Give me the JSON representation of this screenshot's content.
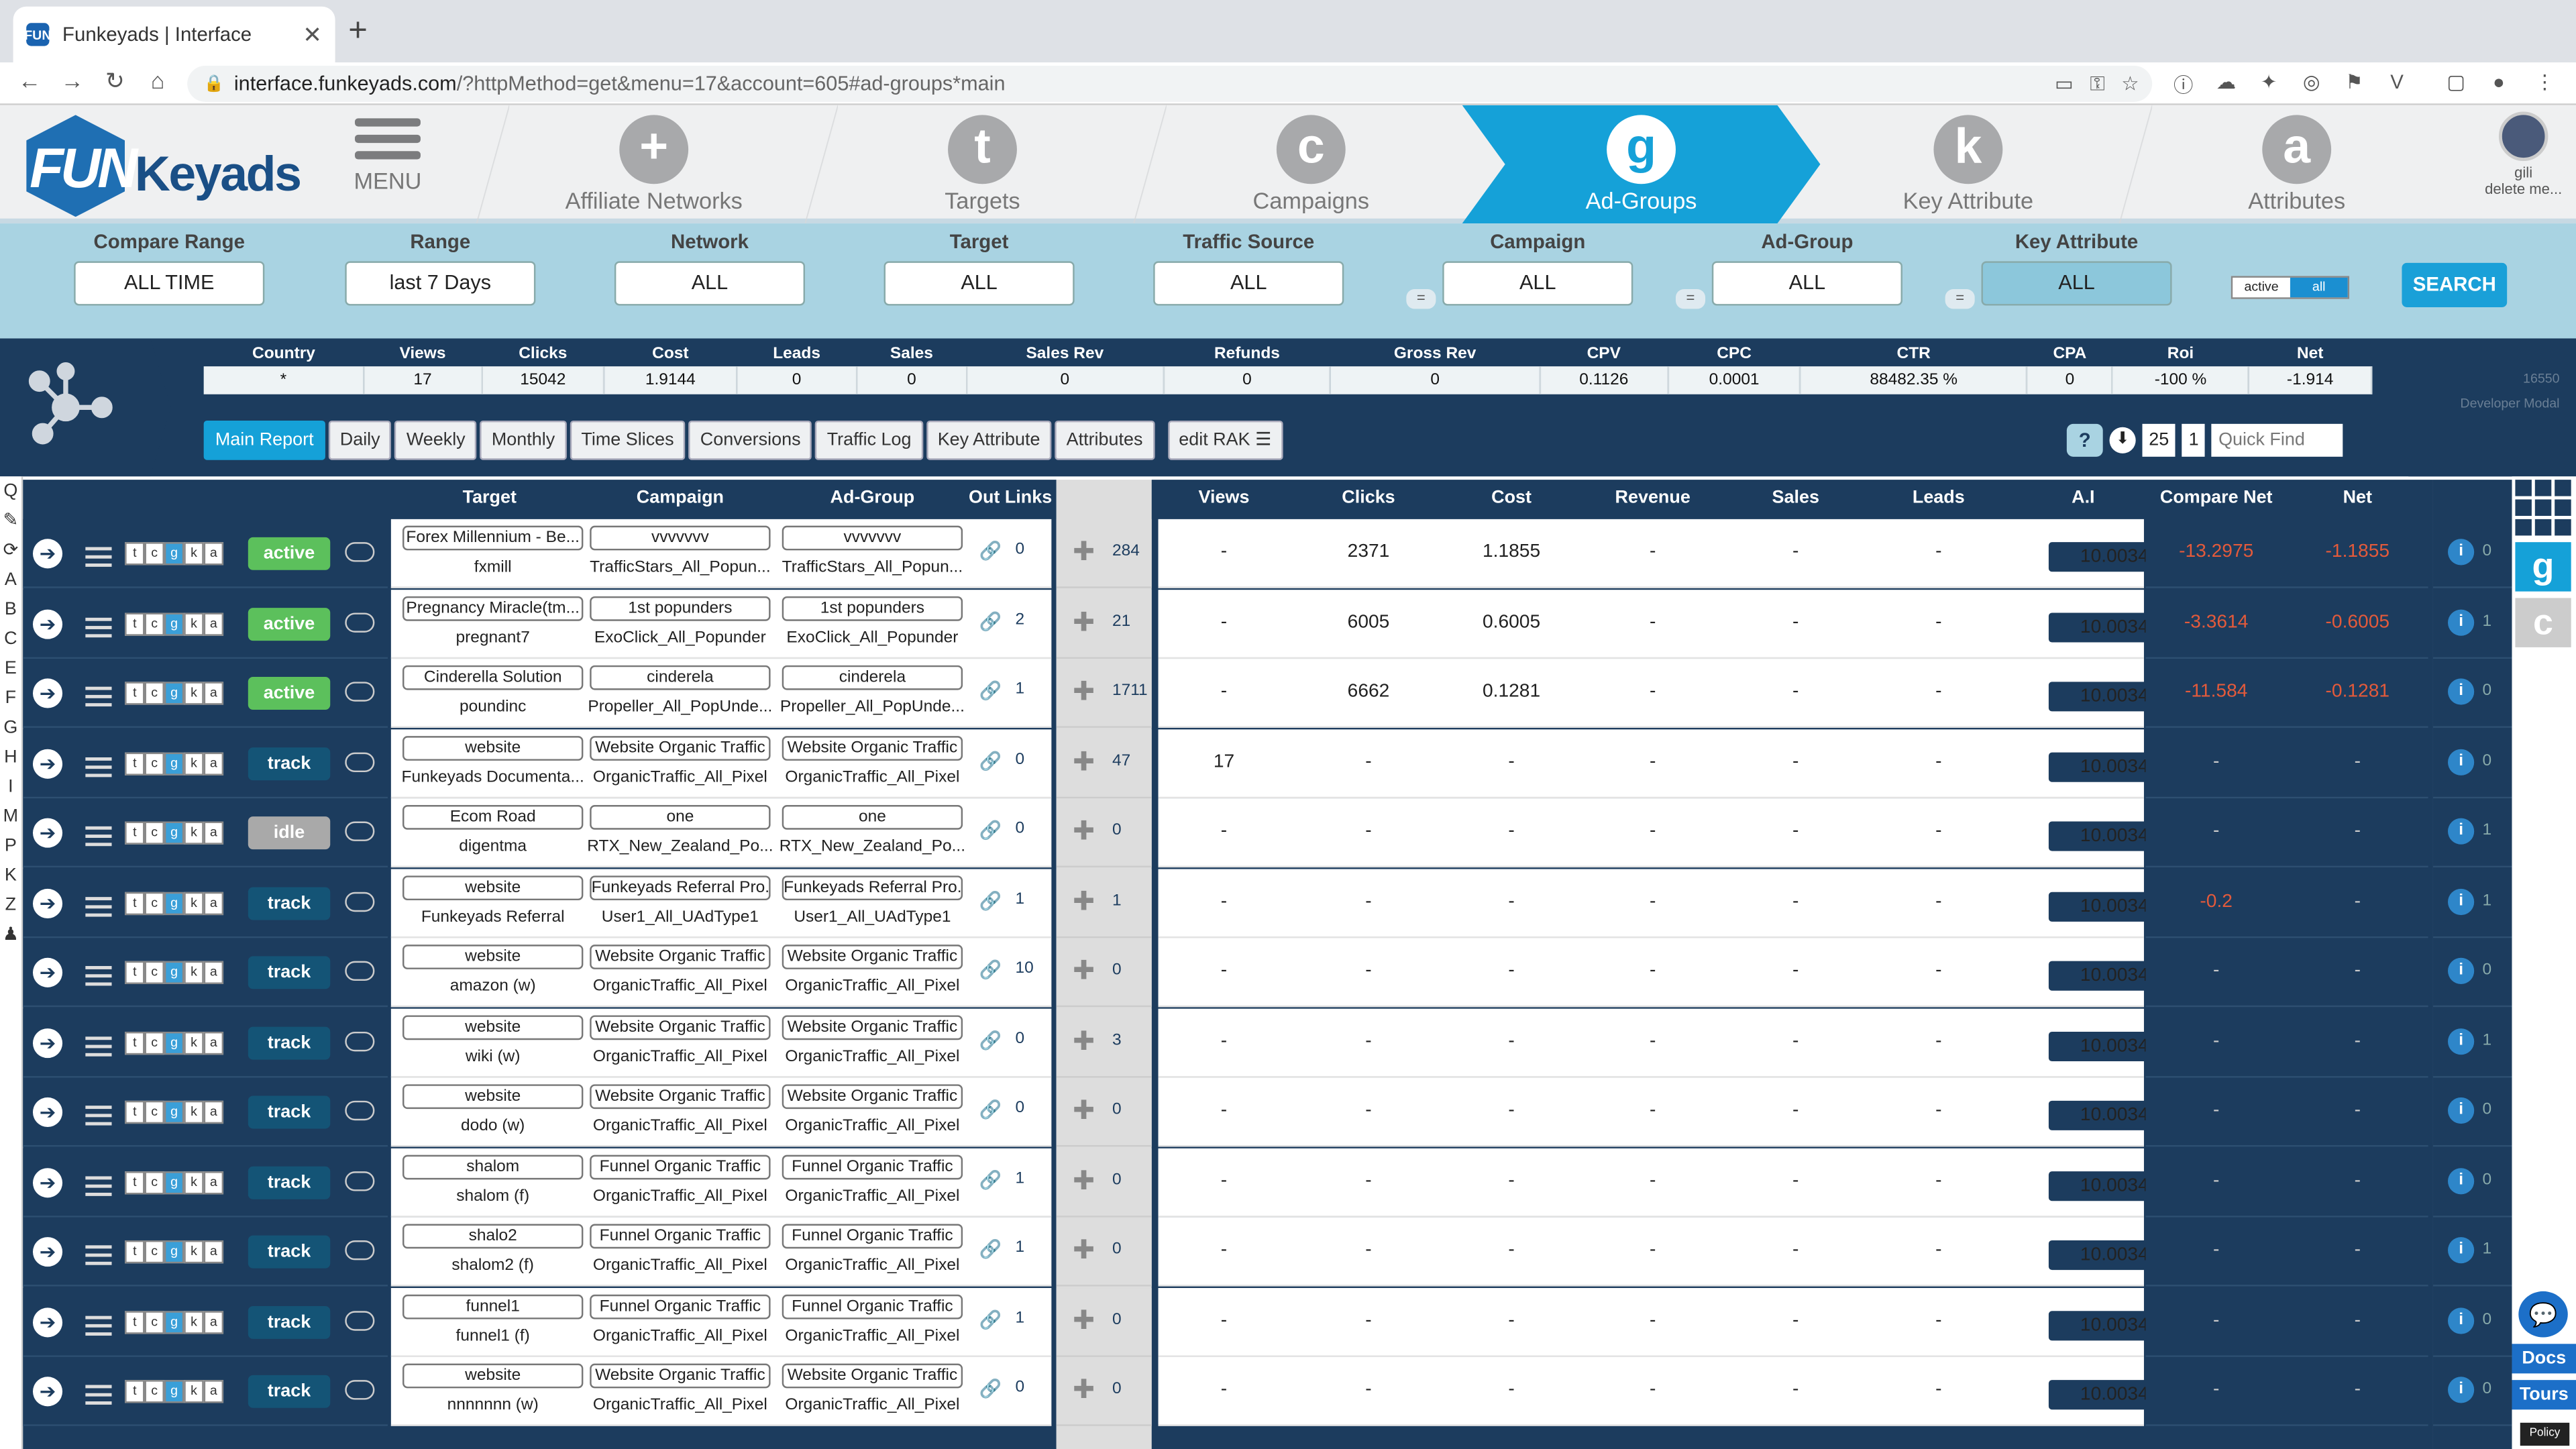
{
  "browser": {
    "tab_title": "Funkeyads | Interface",
    "favicon_text": "FUN",
    "url_host": "interface.funkeyads.com",
    "url_path": "/?httpMethod=get&menu=17&account=605#ad-groups*main"
  },
  "logo": {
    "fun": "FUN",
    "keyads": "Keyads"
  },
  "nav": [
    {
      "label": "MENU",
      "letter": ""
    },
    {
      "label": "Affiliate Networks",
      "letter": "+"
    },
    {
      "label": "Targets",
      "letter": "t"
    },
    {
      "label": "Campaigns",
      "letter": "c"
    },
    {
      "label": "Ad-Groups",
      "letter": "g"
    },
    {
      "label": "Key Attribute",
      "letter": "k"
    },
    {
      "label": "Attributes",
      "letter": "a"
    }
  ],
  "user": {
    "name": "gili",
    "sub": "delete me..."
  },
  "filters": [
    {
      "label": "Compare Range",
      "value": "ALL TIME"
    },
    {
      "label": "Range",
      "value": "last 7 Days"
    },
    {
      "label": "Network",
      "value": "ALL"
    },
    {
      "label": "Target",
      "value": "ALL"
    },
    {
      "label": "Traffic Source",
      "value": "ALL"
    },
    {
      "label": "Campaign",
      "value": "ALL"
    },
    {
      "label": "Ad-Group",
      "value": "ALL"
    },
    {
      "label": "Key Attribute",
      "value": "ALL"
    }
  ],
  "toggle": {
    "a": "active",
    "b": "all"
  },
  "search_label": "SEARCH",
  "summary": {
    "headers": [
      "Country",
      "Views",
      "Clicks",
      "Cost",
      "Leads",
      "Sales",
      "Sales Rev",
      "Refunds",
      "Gross Rev",
      "CPV",
      "CPC",
      "CTR",
      "CPA",
      "Roi",
      "Net"
    ],
    "values": [
      "*",
      "17",
      "15042",
      "1.9144",
      "0",
      "0",
      "0",
      "0",
      "0",
      "0.1126",
      "0.0001",
      "88482.35 %",
      "0",
      "-100 %",
      "-1.914"
    ]
  },
  "developer": {
    "id": "16550",
    "label": "Developer Modal"
  },
  "subtabs": [
    "Main Report",
    "Daily",
    "Weekly",
    "Monthly",
    "Time Slices",
    "Conversions",
    "Traffic Log",
    "Key Attribute",
    "Attributes"
  ],
  "edit_rak": "edit RAK",
  "pager": {
    "help": "?",
    "per_page": "25",
    "page": "1",
    "quick_find": "Quick Find"
  },
  "letters": [
    "Q",
    "✎",
    "⟳",
    "A",
    "B",
    "C",
    "E",
    "F",
    "G",
    "H",
    "I",
    "M",
    "P",
    "K",
    "Z",
    "♟"
  ],
  "columns": {
    "target": "Target",
    "campaign": "Campaign",
    "adgroup": "Ad-Group",
    "outlinks": "Out Links",
    "views": "Views",
    "clicks": "Clicks",
    "cost": "Cost",
    "revenue": "Revenue",
    "sales": "Sales",
    "leads": "Leads",
    "ai": "A.I",
    "compare_net": "Compare Net",
    "net": "Net"
  },
  "letterbox": [
    "t",
    "c",
    "g",
    "k",
    "a"
  ],
  "rows": [
    {
      "status": "active",
      "target_box": "Forex Millennium - Be...",
      "target_sub": "fxmill",
      "camp_box": "vvvvvvv",
      "camp_sub": "TrafficStars_All_Popun...",
      "ag_box": "vvvvvvv",
      "ag_sub": "TrafficStars_All_Popun...",
      "out": "0",
      "mid": "284",
      "views": "-",
      "clicks": "2371",
      "cost": "1.1855",
      "revenue": "-",
      "sales": "-",
      "leads": "-",
      "ai": "10.0034",
      "cnet": "-13.2975",
      "net": "-1.1855",
      "far": "0"
    },
    {
      "status": "active",
      "target_box": "Pregnancy Miracle(tm...",
      "target_sub": "pregnant7",
      "camp_box": "1st popunders",
      "camp_sub": "ExoClick_All_Popunder",
      "ag_box": "1st popunders",
      "ag_sub": "ExoClick_All_Popunder",
      "out": "2",
      "mid": "21",
      "views": "-",
      "clicks": "6005",
      "cost": "0.6005",
      "revenue": "-",
      "sales": "-",
      "leads": "-",
      "ai": "10.0034",
      "cnet": "-3.3614",
      "net": "-0.6005",
      "far": "1"
    },
    {
      "status": "active",
      "target_box": "Cinderella Solution",
      "target_sub": "poundinc",
      "camp_box": "cinderela",
      "camp_sub": "Propeller_All_PopUnde...",
      "ag_box": "cinderela",
      "ag_sub": "Propeller_All_PopUnde...",
      "out": "1",
      "mid": "1711",
      "views": "-",
      "clicks": "6662",
      "cost": "0.1281",
      "revenue": "-",
      "sales": "-",
      "leads": "-",
      "ai": "10.0034",
      "cnet": "-11.584",
      "net": "-0.1281",
      "far": "0"
    },
    {
      "status": "track",
      "target_box": "website",
      "target_sub": "Funkeyads Documenta...",
      "camp_box": "Website Organic Traffic",
      "camp_sub": "OrganicTraffic_All_Pixel",
      "ag_box": "Website Organic Traffic",
      "ag_sub": "OrganicTraffic_All_Pixel",
      "out": "0",
      "mid": "47",
      "views": "17",
      "clicks": "-",
      "cost": "-",
      "revenue": "-",
      "sales": "-",
      "leads": "-",
      "ai": "10.0034",
      "cnet": "-",
      "net": "-",
      "far": "0"
    },
    {
      "status": "idle",
      "target_box": "Ecom Road",
      "target_sub": "digentma",
      "camp_box": "one",
      "camp_sub": "RTX_New_Zealand_Po...",
      "ag_box": "one",
      "ag_sub": "RTX_New_Zealand_Po...",
      "out": "0",
      "mid": "0",
      "views": "-",
      "clicks": "-",
      "cost": "-",
      "revenue": "-",
      "sales": "-",
      "leads": "-",
      "ai": "10.0034",
      "cnet": "-",
      "net": "-",
      "far": "1"
    },
    {
      "status": "track",
      "target_box": "website",
      "target_sub": "Funkeyads Referral",
      "camp_box": "Funkeyads Referral Pro...",
      "camp_sub": "User1_All_UAdType1",
      "ag_box": "Funkeyads Referral Pro...",
      "ag_sub": "User1_All_UAdType1",
      "out": "1",
      "mid": "1",
      "views": "-",
      "clicks": "-",
      "cost": "-",
      "revenue": "-",
      "sales": "-",
      "leads": "-",
      "ai": "10.0034",
      "cnet": "-0.2",
      "net": "-",
      "far": "1"
    },
    {
      "status": "track",
      "target_box": "website",
      "target_sub": "amazon (w)",
      "camp_box": "Website Organic Traffic",
      "camp_sub": "OrganicTraffic_All_Pixel",
      "ag_box": "Website Organic Traffic",
      "ag_sub": "OrganicTraffic_All_Pixel",
      "out": "10",
      "mid": "0",
      "views": "-",
      "clicks": "-",
      "cost": "-",
      "revenue": "-",
      "sales": "-",
      "leads": "-",
      "ai": "10.0034",
      "cnet": "-",
      "net": "-",
      "far": "0"
    },
    {
      "status": "track",
      "target_box": "website",
      "target_sub": "wiki (w)",
      "camp_box": "Website Organic Traffic",
      "camp_sub": "OrganicTraffic_All_Pixel",
      "ag_box": "Website Organic Traffic",
      "ag_sub": "OrganicTraffic_All_Pixel",
      "out": "0",
      "mid": "3",
      "views": "-",
      "clicks": "-",
      "cost": "-",
      "revenue": "-",
      "sales": "-",
      "leads": "-",
      "ai": "10.0034",
      "cnet": "-",
      "net": "-",
      "far": "1"
    },
    {
      "status": "track",
      "target_box": "website",
      "target_sub": "dodo (w)",
      "camp_box": "Website Organic Traffic",
      "camp_sub": "OrganicTraffic_All_Pixel",
      "ag_box": "Website Organic Traffic",
      "ag_sub": "OrganicTraffic_All_Pixel",
      "out": "0",
      "mid": "0",
      "views": "-",
      "clicks": "-",
      "cost": "-",
      "revenue": "-",
      "sales": "-",
      "leads": "-",
      "ai": "10.0034",
      "cnet": "-",
      "net": "-",
      "far": "0"
    },
    {
      "status": "track",
      "target_box": "shalom",
      "target_sub": "shalom (f)",
      "camp_box": "Funnel Organic Traffic",
      "camp_sub": "OrganicTraffic_All_Pixel",
      "ag_box": "Funnel Organic Traffic",
      "ag_sub": "OrganicTraffic_All_Pixel",
      "out": "1",
      "mid": "0",
      "views": "-",
      "clicks": "-",
      "cost": "-",
      "revenue": "-",
      "sales": "-",
      "leads": "-",
      "ai": "10.0034",
      "cnet": "-",
      "net": "-",
      "far": "0"
    },
    {
      "status": "track",
      "target_box": "shalo2",
      "target_sub": "shalom2 (f)",
      "camp_box": "Funnel Organic Traffic",
      "camp_sub": "OrganicTraffic_All_Pixel",
      "ag_box": "Funnel Organic Traffic",
      "ag_sub": "OrganicTraffic_All_Pixel",
      "out": "1",
      "mid": "0",
      "views": "-",
      "clicks": "-",
      "cost": "-",
      "revenue": "-",
      "sales": "-",
      "leads": "-",
      "ai": "10.0034",
      "cnet": "-",
      "net": "-",
      "far": "1"
    },
    {
      "status": "track",
      "target_box": "funnel1",
      "target_sub": "funnel1 (f)",
      "camp_box": "Funnel Organic Traffic",
      "camp_sub": "OrganicTraffic_All_Pixel",
      "ag_box": "Funnel Organic Traffic",
      "ag_sub": "OrganicTraffic_All_Pixel",
      "out": "1",
      "mid": "0",
      "views": "-",
      "clicks": "-",
      "cost": "-",
      "revenue": "-",
      "sales": "-",
      "leads": "-",
      "ai": "10.0034",
      "cnet": "-",
      "net": "-",
      "far": "0"
    },
    {
      "status": "track",
      "target_box": "website",
      "target_sub": "nnnnnnn (w)",
      "camp_box": "Website Organic Traffic",
      "camp_sub": "OrganicTraffic_All_Pixel",
      "ag_box": "Website Organic Traffic",
      "ag_sub": "OrganicTraffic_All_Pixel",
      "out": "0",
      "mid": "0",
      "views": "-",
      "clicks": "-",
      "cost": "-",
      "revenue": "-",
      "sales": "-",
      "leads": "-",
      "ai": "10.0034",
      "cnet": "-",
      "net": "-",
      "far": "0"
    }
  ],
  "rail": {
    "g": "g",
    "c": "c",
    "docs": "Docs",
    "tours": "Tours",
    "policy": "Policy"
  }
}
